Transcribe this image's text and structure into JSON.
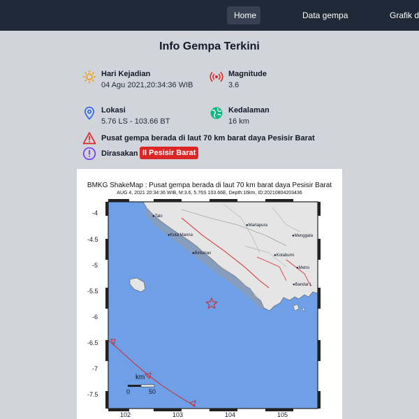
{
  "nav": {
    "items": [
      {
        "label": "Home",
        "active": true
      },
      {
        "label": "Data gempa",
        "active": false
      },
      {
        "label": "Grafik data",
        "active": false
      }
    ]
  },
  "title": "Info Gempa Terkini",
  "info": {
    "hari": {
      "label": "Hari Kejadian",
      "value": "04 Agu 2021,20:34:36 WIB",
      "icon": "sun-icon"
    },
    "magnitude": {
      "label": "Magnitude",
      "value": "3.6",
      "icon": "broadcast-icon"
    },
    "lokasi": {
      "label": "Lokasi",
      "value": "5.76 LS - 103.66 BT",
      "icon": "map-pin-icon"
    },
    "kedalaman": {
      "label": "Kedalaman",
      "value": "16 km",
      "icon": "globe-icon"
    }
  },
  "pusat": {
    "text": "Pusat gempa berada di laut 70 km barat daya Pesisir Barat",
    "icon": "warning-triangle-icon"
  },
  "dirasakan": {
    "label": "Dirasakan :",
    "badge": "II Pesisir Barat",
    "icon": "exclamation-circle-icon"
  },
  "map": {
    "title": "BMKG ShakeMap : Pusat gempa berada di laut 70 km barat daya Pesisir Barat",
    "subtitle": "AUG 4, 2021 20:34:36 WIB, M:3.6, 5.76S 103.66E, Depth:16km, ID:20210804203436",
    "lat_ticks": [
      "-4",
      "-4.5",
      "-5",
      "-5.5",
      "-6",
      "-6.5",
      "-7",
      "-7.5"
    ],
    "lon_ticks": [
      "102",
      "103",
      "104",
      "105"
    ],
    "cities": [
      "Talo",
      "Kota Manna",
      "Martapura",
      "Menggala",
      "Bintuhan",
      "Kotabumi",
      "Metro",
      "Bandar L"
    ],
    "scale": {
      "unit": "km",
      "start": "0",
      "end": "50"
    }
  },
  "colors": {
    "navbar": "#1f2937",
    "accent": "#dc2626",
    "sun": "#f59e0b",
    "pin": "#2563eb",
    "globe": "#10b981",
    "warning": "#dc2626",
    "dirasakan": "#7c3aed",
    "sea": "#6f9fe6"
  }
}
